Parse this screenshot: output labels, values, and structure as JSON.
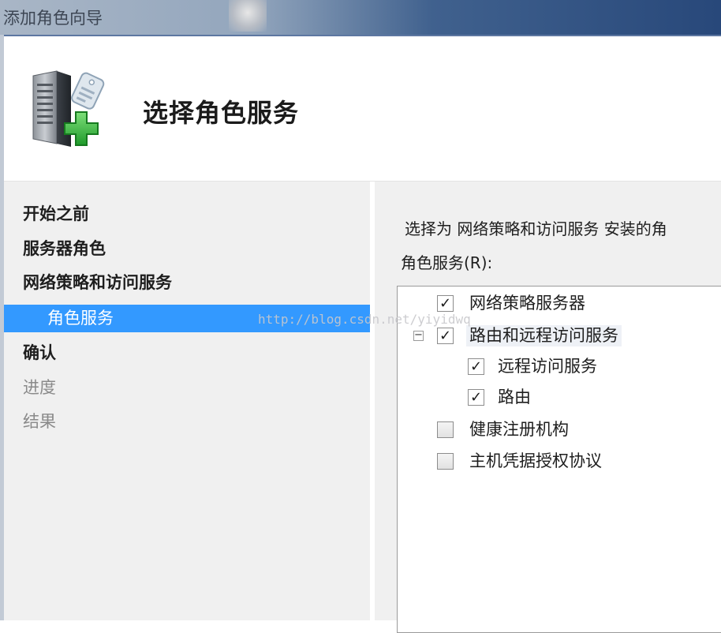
{
  "window": {
    "title": "添加角色向导"
  },
  "header": {
    "page_title": "选择角色服务",
    "icon": "server-add-icon"
  },
  "sidebar": {
    "items": [
      {
        "label": "开始之前",
        "state": "visited"
      },
      {
        "label": "服务器角色",
        "state": "visited"
      },
      {
        "label": "网络策略和访问服务",
        "state": "visited"
      },
      {
        "label": "角色服务",
        "state": "selected"
      },
      {
        "label": "确认",
        "state": "visited"
      },
      {
        "label": "进度",
        "state": "pending"
      },
      {
        "label": "结果",
        "state": "pending"
      }
    ],
    "selected_color": "#3399ff"
  },
  "main": {
    "description": "选择为 网络策略和访问服务 安装的角",
    "list_label": "角色服务(R):",
    "services": [
      {
        "label": "网络策略服务器",
        "checked": true,
        "level": 0
      },
      {
        "label": "路由和远程访问服务",
        "checked": true,
        "level": 0,
        "expanded": true
      },
      {
        "label": "远程访问服务",
        "checked": true,
        "level": 1
      },
      {
        "label": "路由",
        "checked": true,
        "level": 1
      },
      {
        "label": "健康注册机构",
        "checked": false,
        "level": 0
      },
      {
        "label": "主机凭据授权协议",
        "checked": false,
        "level": 0
      }
    ],
    "expander_symbol": "−"
  },
  "watermark": "http://blog.csdn.net/yiyidwq"
}
